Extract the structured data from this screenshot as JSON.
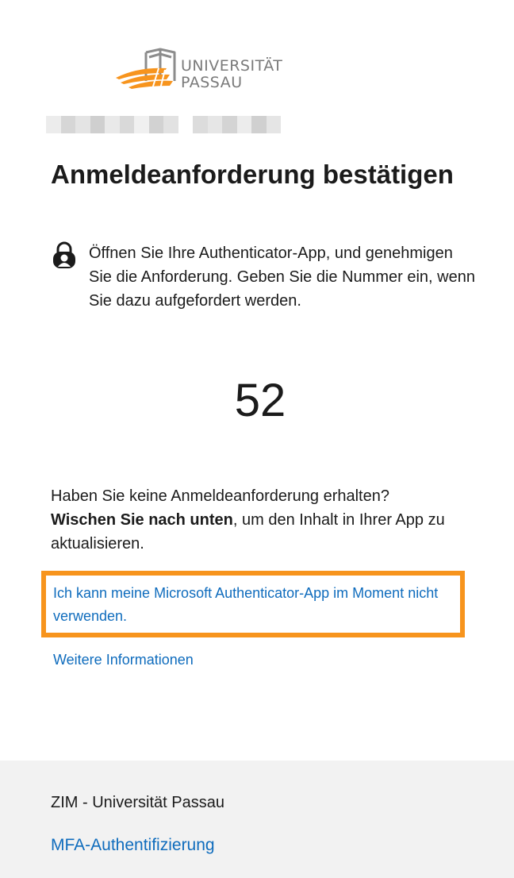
{
  "logo": {
    "line1": "UNIVERSITÄT",
    "line2": "PASSAU",
    "colors": {
      "orange": "#f7941d",
      "gray": "#7a7a7a"
    }
  },
  "account": {
    "icon": "blurred-account-name"
  },
  "title": "Anmeldeanforderung bestätigen",
  "instruction": {
    "icon": "lock-person-icon",
    "text": "Öffnen Sie Ihre Authenticator-App, und genehmigen Sie die Anforderung. Geben Sie die Nummer ein, wenn Sie dazu aufgefordert werden."
  },
  "number": "52",
  "not_received": {
    "question": "Haben Sie keine Anmeldeanforderung erhalten?",
    "bold": "Wischen Sie nach unten",
    "rest": ", um den Inhalt in Ihrer App zu aktualisieren."
  },
  "links": {
    "cant_use": "Ich kann meine Microsoft Authenticator-App im Moment nicht verwenden.",
    "more_info": "Weitere Informationen"
  },
  "footer": {
    "org": "ZIM - Universität Passau",
    "link": "MFA-Authentifizierung"
  },
  "colors": {
    "link": "#0f6cbd",
    "highlight": "#f7941d",
    "footer_bg": "#f2f2f2",
    "text": "#1b1b1b"
  }
}
